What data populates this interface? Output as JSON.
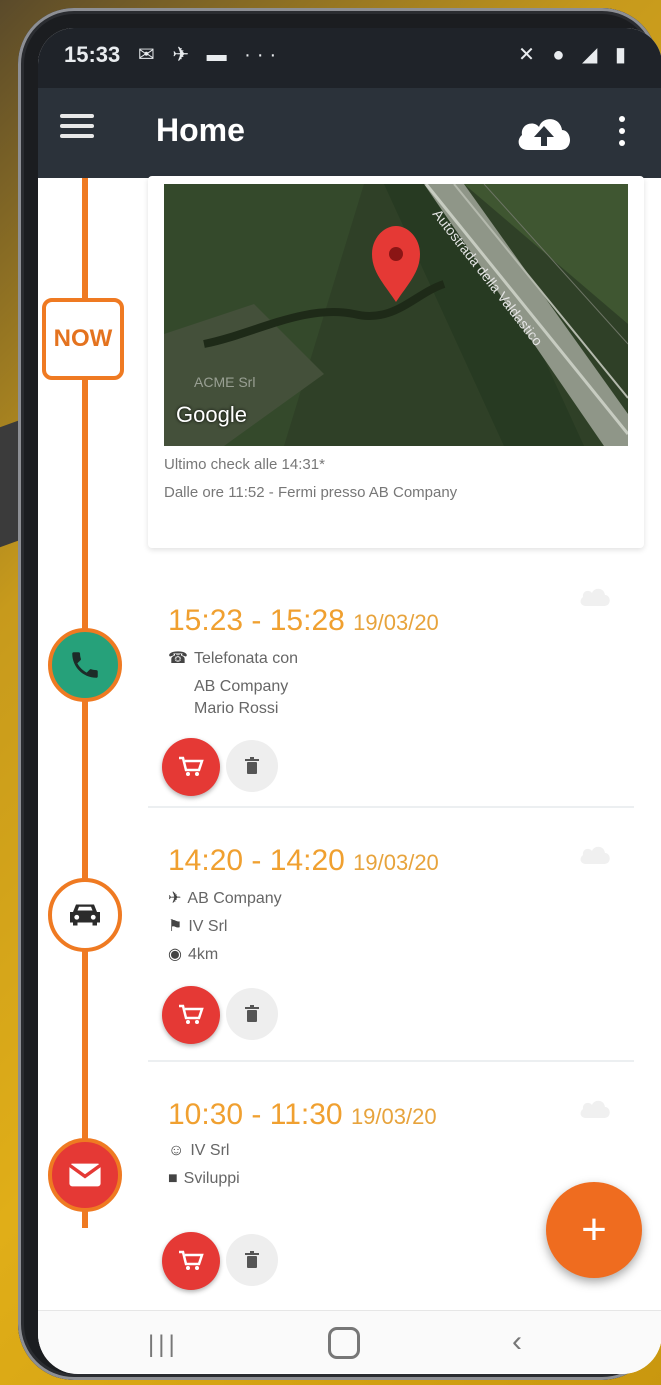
{
  "status_bar": {
    "time": "15:33",
    "left_icons": "✉ ✈ ▬ ···",
    "right_icons": "✕ ● ◢ ▮"
  },
  "app_bar": {
    "title": "Home"
  },
  "timeline": {
    "now_label": "NOW",
    "accent_color": "#ef7a22"
  },
  "map_card": {
    "map_provider": "Google",
    "road_label": "Autostrada della Valdastico",
    "overlay_text": "ACME Srl",
    "last_check": "Ultimo check alle 14:31*",
    "since": "Dalle ore 11:52 - Fermi presso AB Company"
  },
  "events": [
    {
      "type": "call",
      "icon": "phone-icon",
      "time_range": "15:23 - 15:28",
      "date": "19/03/20",
      "label": "Telefonata con",
      "company": "AB Company",
      "person": "Mario Rossi"
    },
    {
      "type": "trip",
      "icon": "car-icon",
      "time_range": "14:20 - 14:20",
      "date": "19/03/20",
      "from": "AB Company",
      "to": "IV Srl",
      "distance": "4km"
    },
    {
      "type": "email",
      "icon": "envelope-icon",
      "time_range": "10:30 - 11:30",
      "date": "19/03/20",
      "contact": "IV Srl",
      "project": "Sviluppi"
    }
  ],
  "fab_label": "+",
  "colors": {
    "appbar": "#2b323a",
    "accent": "#ef7a22",
    "time_text": "#f0a030",
    "cart_button": "#e53935",
    "call_icon_bg": "#26a17a",
    "email_icon_bg": "#e53935"
  }
}
